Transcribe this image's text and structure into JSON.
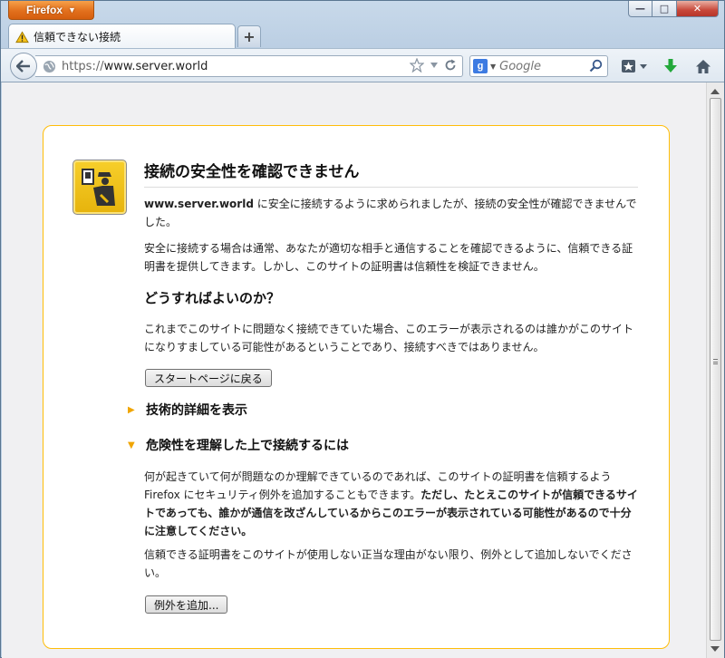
{
  "window": {
    "app_button": "Firefox",
    "controls": {
      "minimize": "—",
      "maximize": "□",
      "close": "✕"
    }
  },
  "tab": {
    "title": "信頼できない接続",
    "new_tab": "+"
  },
  "navbar": {
    "url_protocol": "https://",
    "url_host": "www.server.world",
    "search_placeholder": "Google",
    "search_engine": "g"
  },
  "page": {
    "title": "接続の安全性を確認できません",
    "p1_host": "www.server.world",
    "p1_rest": " に安全に接続するように求められましたが、接続の安全性が確認できませんでした。",
    "p2": "安全に接続する場合は通常、あなたが適切な相手と通信することを確認できるように、信頼できる証明書を提供してきます。しかし、このサイトの証明書は信頼性を検証できません。",
    "h2": "どうすればよいのか？",
    "p3": "これまでこのサイトに問題なく接続できていた場合、このエラーが表示されるのは誰かがこのサイトになりすましている可能性があるということであり、接続すべきではありません。",
    "back_button": "スタートページに戻る",
    "technical_details": "技術的詳細を表示",
    "understand_risks": "危険性を理解した上で接続するには",
    "p4_normal": "何が起きていて何が問題なのか理解できているのであれば、このサイトの証明書を信頼するよう Firefox にセキュリティ例外を追加することもできます。",
    "p4_bold": "ただし、たとえこのサイトが信頼できるサイトであっても、誰かが通信を改ざんしているからこのエラーが表示されている可能性があるので十分に注意してください。",
    "p5": "信頼できる証明書をこのサイトが使用しない正当な理由がない限り、例外として追加しないでください。",
    "add_exception_button": "例外を追加..."
  },
  "colors": {
    "panel_border": "#ffbd09",
    "app_button": "#e2701d",
    "expander_arrow": "#f0a500"
  }
}
